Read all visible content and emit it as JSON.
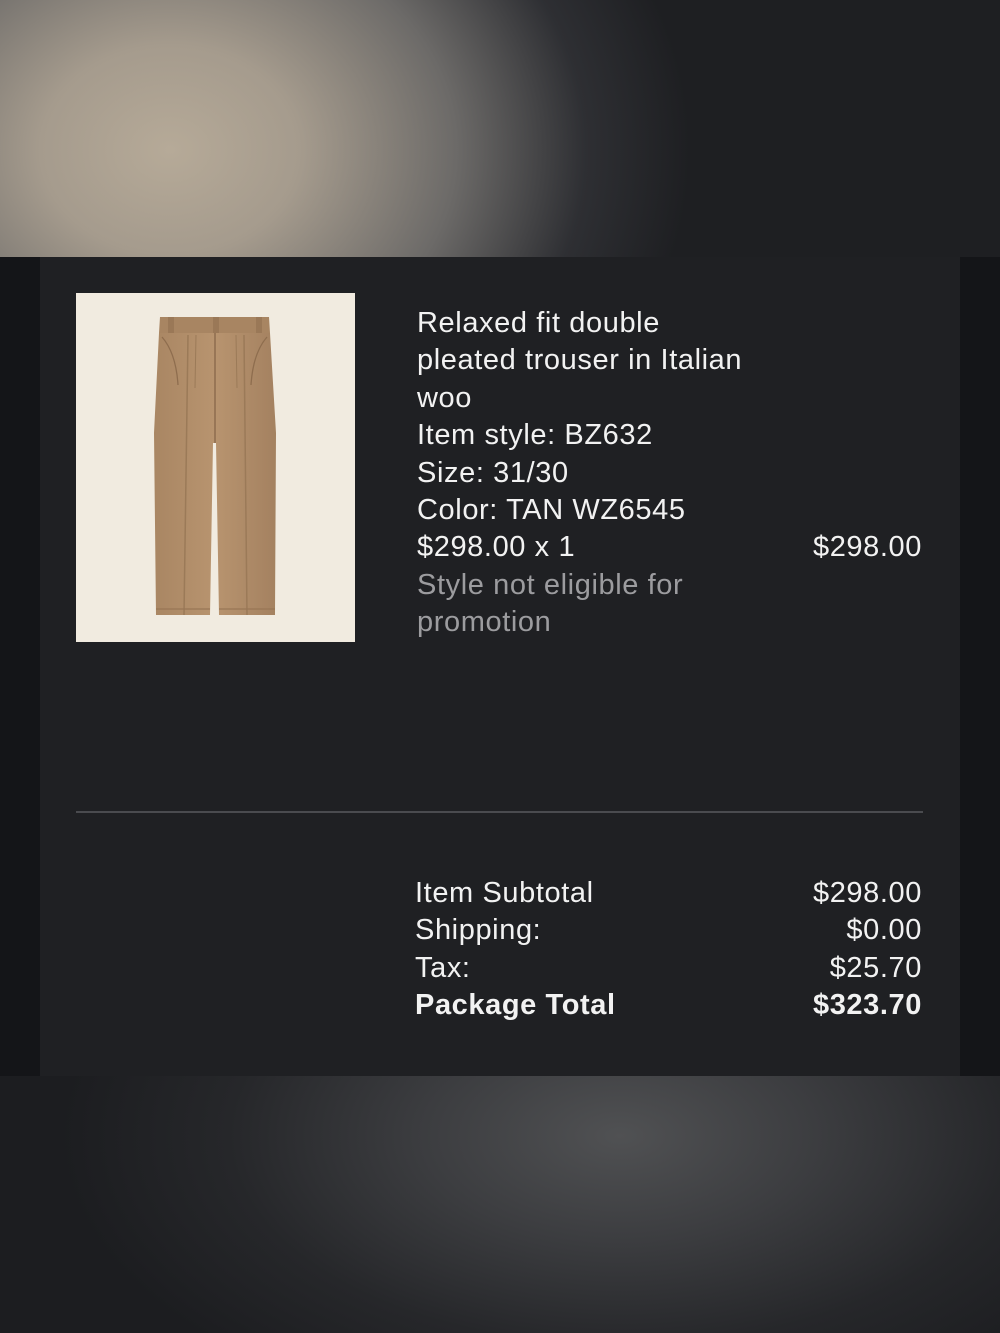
{
  "product": {
    "image_alt": "Tan relaxed fit double pleated trousers",
    "name": "Relaxed fit double pleated trouser in Italian woo",
    "style": "Item style: BZ632",
    "size": "Size: 31/30",
    "color": "Color: TAN WZ6545",
    "qty_price": "$298.00 x 1",
    "line_total": "$298.00",
    "promo_note": "Style not eligible for promotion"
  },
  "summary": {
    "subtotal_label": "Item Subtotal",
    "subtotal_value": "$298.00",
    "shipping_label": "Shipping:",
    "shipping_value": "$0.00",
    "tax_label": "Tax:",
    "tax_value": "$25.70",
    "total_label": "Package Total",
    "total_value": "$323.70"
  },
  "colors": {
    "panel_background": "#1f2023",
    "text_primary": "#f2f2f2",
    "text_muted": "#9c9c9f",
    "product_tan": "#b08e6b",
    "image_background": "#f1ebe0"
  }
}
